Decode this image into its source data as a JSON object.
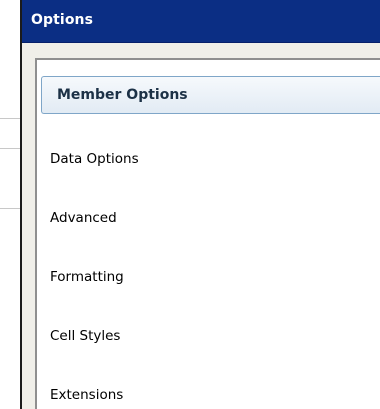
{
  "window": {
    "title": "Options"
  },
  "nav": {
    "items": [
      {
        "label": "Member Options",
        "selected": true
      },
      {
        "label": "Data Options",
        "selected": false
      },
      {
        "label": "Advanced",
        "selected": false
      },
      {
        "label": "Formatting",
        "selected": false
      },
      {
        "label": "Cell Styles",
        "selected": false
      },
      {
        "label": "Extensions",
        "selected": false
      }
    ]
  },
  "colors": {
    "title_bar": "#0b2e84",
    "dialog_background": "#f0efe9",
    "selected_item_border": "#7fa6c8",
    "selected_item_text": "#1c3146"
  }
}
